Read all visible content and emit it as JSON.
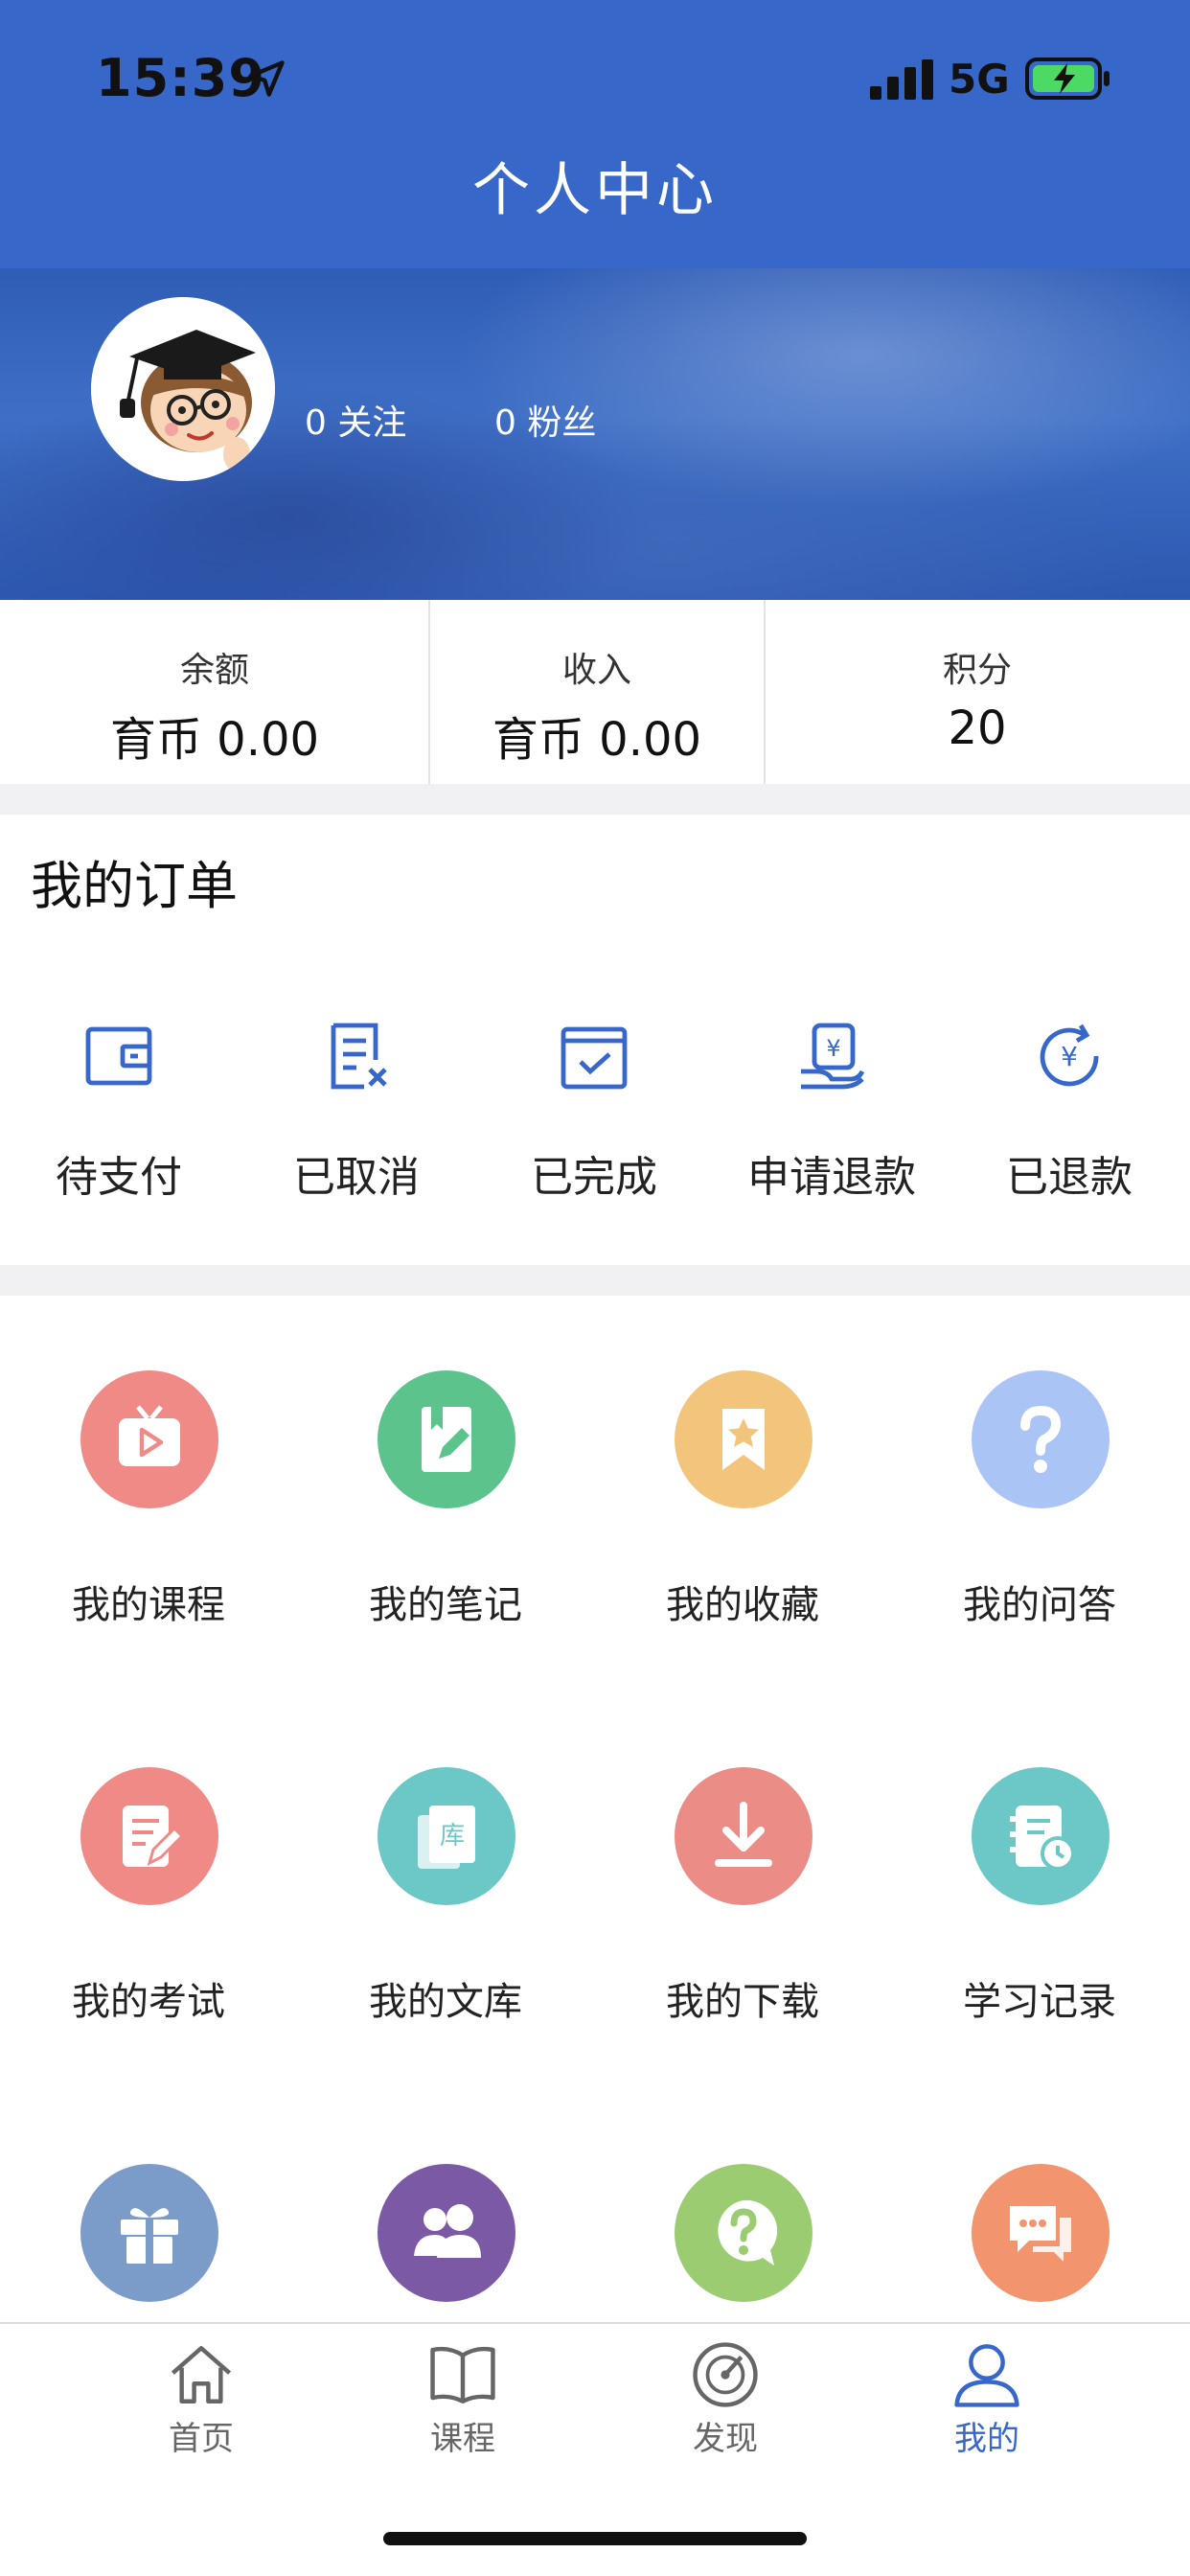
{
  "status_bar": {
    "time": "15:39",
    "network": "5G"
  },
  "header": {
    "title": "个人中心"
  },
  "profile": {
    "follow": "0 关注",
    "fans": "0 粉丝"
  },
  "stats": [
    {
      "label": "余额",
      "value": "育币 0.00"
    },
    {
      "label": "收入",
      "value": "育币 0.00"
    },
    {
      "label": "积分",
      "value": "20"
    }
  ],
  "orders": {
    "title": "我的订单",
    "items": [
      {
        "label": "待支付",
        "icon": "wallet-icon"
      },
      {
        "label": "已取消",
        "icon": "cancelled-doc-icon"
      },
      {
        "label": "已完成",
        "icon": "calendar-check-icon"
      },
      {
        "label": "申请退款",
        "icon": "refund-request-icon"
      },
      {
        "label": "已退款",
        "icon": "refunded-icon"
      }
    ]
  },
  "grid": [
    {
      "label": "我的课程",
      "icon": "video-icon",
      "color": "#ef8a86"
    },
    {
      "label": "我的笔记",
      "icon": "note-icon",
      "color": "#5dc38c"
    },
    {
      "label": "我的收藏",
      "icon": "bookmark-star-icon",
      "color": "#f3c47b"
    },
    {
      "label": "我的问答",
      "icon": "question-icon",
      "color": "#a9c4f5"
    },
    {
      "label": "我的考试",
      "icon": "exam-icon",
      "color": "#ef8a86"
    },
    {
      "label": "我的文库",
      "icon": "library-icon",
      "color": "#6cc8c6"
    },
    {
      "label": "我的下载",
      "icon": "download-icon",
      "color": "#ec8c86"
    },
    {
      "label": "学习记录",
      "icon": "study-record-icon",
      "color": "#6cc8c6"
    },
    {
      "label": "",
      "icon": "gift-icon",
      "color": "#7b9cc9"
    },
    {
      "label": "",
      "icon": "group-icon",
      "color": "#7c59a4"
    },
    {
      "label": "",
      "icon": "help-bubble-icon",
      "color": "#9ccc72"
    },
    {
      "label": "",
      "icon": "message-icon",
      "color": "#f2946e"
    }
  ],
  "tabbar": [
    {
      "label": "首页",
      "icon": "home-icon",
      "active": false
    },
    {
      "label": "课程",
      "icon": "book-icon",
      "active": false
    },
    {
      "label": "发现",
      "icon": "compass-icon",
      "active": false
    },
    {
      "label": "我的",
      "icon": "user-icon",
      "active": true
    }
  ],
  "colors": {
    "primary": "#3767c9",
    "divider": "#f1f1f4"
  }
}
